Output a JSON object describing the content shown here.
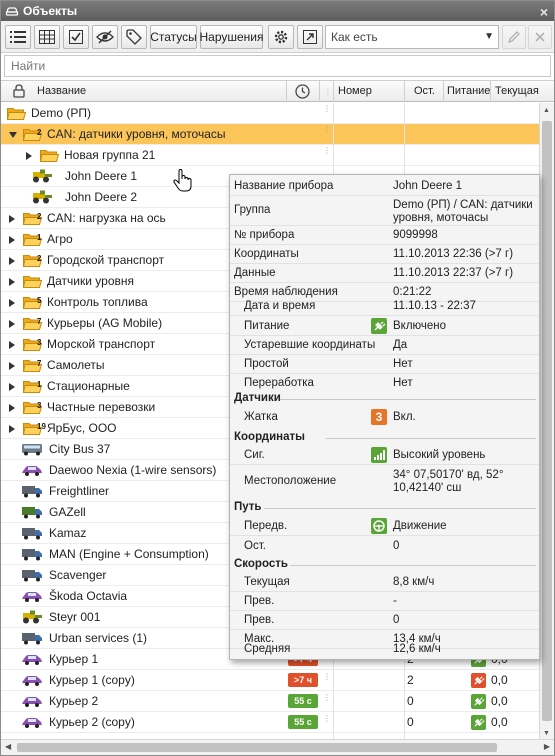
{
  "window": {
    "title": "Объекты"
  },
  "toolbar": {
    "statuses_label": "Статусы",
    "violations_label": "Нарушения",
    "dropdown_value": "Как есть"
  },
  "search": {
    "placeholder": "Найти"
  },
  "columns": {
    "name": "Название",
    "number": "Номер",
    "stops": "Ост.",
    "power": "Питание",
    "speed": "Текущая"
  },
  "tree": [
    {
      "label": "Demo (РП)",
      "type": "folder",
      "level": 0,
      "expanded": true,
      "count": ""
    },
    {
      "label": "CAN: датчики уровня, моточасы",
      "type": "folder",
      "level": 1,
      "expanded": true,
      "count": "2",
      "selected": true
    },
    {
      "label": "Новая группа 21",
      "type": "folder",
      "level": 2,
      "expanded": false,
      "count": ""
    },
    {
      "label": "John Deere 1",
      "type": "tractor",
      "level": 2
    },
    {
      "label": "John Deere 2",
      "type": "tractor",
      "level": 2
    },
    {
      "label": "CAN: нагрузка на ось",
      "type": "folder",
      "level": 1,
      "count": "2"
    },
    {
      "label": "Агро",
      "type": "folder",
      "level": 1,
      "count": "1"
    },
    {
      "label": "Городской транспорт",
      "type": "folder",
      "level": 1,
      "count": "2"
    },
    {
      "label": "Датчики уровня",
      "type": "folder",
      "level": 1,
      "count": ""
    },
    {
      "label": "Контроль топлива",
      "type": "folder",
      "level": 1,
      "count": "5"
    },
    {
      "label": "Курьеры (AG Mobile)",
      "type": "folder",
      "level": 1,
      "count": "7"
    },
    {
      "label": "Морской транспорт",
      "type": "folder",
      "level": 1,
      "count": "3"
    },
    {
      "label": "Самолеты",
      "type": "folder",
      "level": 1,
      "count": "7"
    },
    {
      "label": "Стационарные",
      "type": "folder",
      "level": 1,
      "count": "1"
    },
    {
      "label": "Частные перевозки",
      "type": "folder",
      "level": 1,
      "count": "3"
    },
    {
      "label": "ЯрБус, ООО",
      "type": "folder",
      "level": 1,
      "count": "19"
    },
    {
      "label": "City Bus 37",
      "type": "bus",
      "level": 1
    },
    {
      "label": "Daewoo Nexia (1-wire sensors)",
      "type": "car",
      "level": 1
    },
    {
      "label": "Freightliner",
      "type": "truck",
      "level": 1
    },
    {
      "label": "GAZell",
      "type": "van",
      "level": 1
    },
    {
      "label": "Kamaz",
      "type": "truck",
      "level": 1
    },
    {
      "label": "MAN (Engine + Consumption)",
      "type": "truck",
      "level": 1
    },
    {
      "label": "Scavenger",
      "type": "truck",
      "level": 1
    },
    {
      "label": "Škoda Octavia",
      "type": "car",
      "level": 1
    },
    {
      "label": "Steyr 001",
      "type": "tractor",
      "level": 1
    },
    {
      "label": "Urban services (1)",
      "type": "truck",
      "level": 1
    },
    {
      "label": "Курьер 1",
      "type": "car",
      "level": 1,
      "badge": ">7 ч",
      "badge_color": "#e0502a",
      "stops": "2",
      "power": "ok",
      "speed": "0,0"
    },
    {
      "label": "Курьер 1 (copy)",
      "type": "car",
      "level": 1,
      "badge": ">7 ч",
      "badge_color": "#e0502a",
      "stops": "2",
      "power": "off",
      "speed": "0,0"
    },
    {
      "label": "Курьер 2",
      "type": "car",
      "level": 1,
      "badge": "55 с",
      "badge_color": "#5aa538",
      "stops": "0",
      "power": "ok",
      "speed": "0,0"
    },
    {
      "label": "Курьер 2 (copy)",
      "type": "car",
      "level": 1,
      "badge": "55 с",
      "badge_color": "#5aa538",
      "stops": "0",
      "power": "ok",
      "speed": "0,0"
    }
  ],
  "tooltip": {
    "device_name_label": "Название прибора",
    "device_name": "John Deere 1",
    "group_label": "Группа",
    "group_value": "Demo (РП) / CAN: датчики уровня, моточасы",
    "device_no_label": "№ прибора",
    "device_no": "9099998",
    "coords_label": "Координаты",
    "coords": "11.10.2013 22:36 (>7 г)",
    "data_label": "Данные",
    "data": "11.10.2013 22:37 (>7 г)",
    "observe_label": "Время наблюдения",
    "observe": "0:21:22",
    "datetime_label": "Дата и время",
    "datetime": "11.10.13 - 22:37",
    "power_label": "Питание",
    "power": "Включено",
    "stale_label": "Устаревшие координаты",
    "stale": "Да",
    "idle_label": "Простой",
    "idle": "Нет",
    "overwork_label": "Переработка",
    "overwork": "Нет",
    "sensors_section": "Датчики",
    "header_label": "Жатка",
    "header_num": "3",
    "header_value": "Вкл.",
    "coords_section": "Координаты",
    "signal_label": "Сиг.",
    "signal": "Высокий уровень",
    "location_label": "Местоположение",
    "location": "34° 07,50170' вд, 52° 10,42140' сш",
    "path_section": "Путь",
    "move_label": "Передв.",
    "move": "Движение",
    "stops_label": "Ост.",
    "stops": "0",
    "speed_section": "Скорость",
    "cur_label": "Текущая",
    "cur": "8,8 км/ч",
    "prev1_label": "Прев.",
    "prev1": "-",
    "prev2_label": "Прев.",
    "prev2": "0",
    "max_label": "Макс.",
    "max": "13,4 км/ч",
    "avg_label": "Средняя",
    "avg": "12,6 км/ч"
  },
  "colors": {
    "selected": "#fbc55a",
    "folder": "#f5b731",
    "ok_green": "#5aa538",
    "warn_red": "#e0502a"
  }
}
